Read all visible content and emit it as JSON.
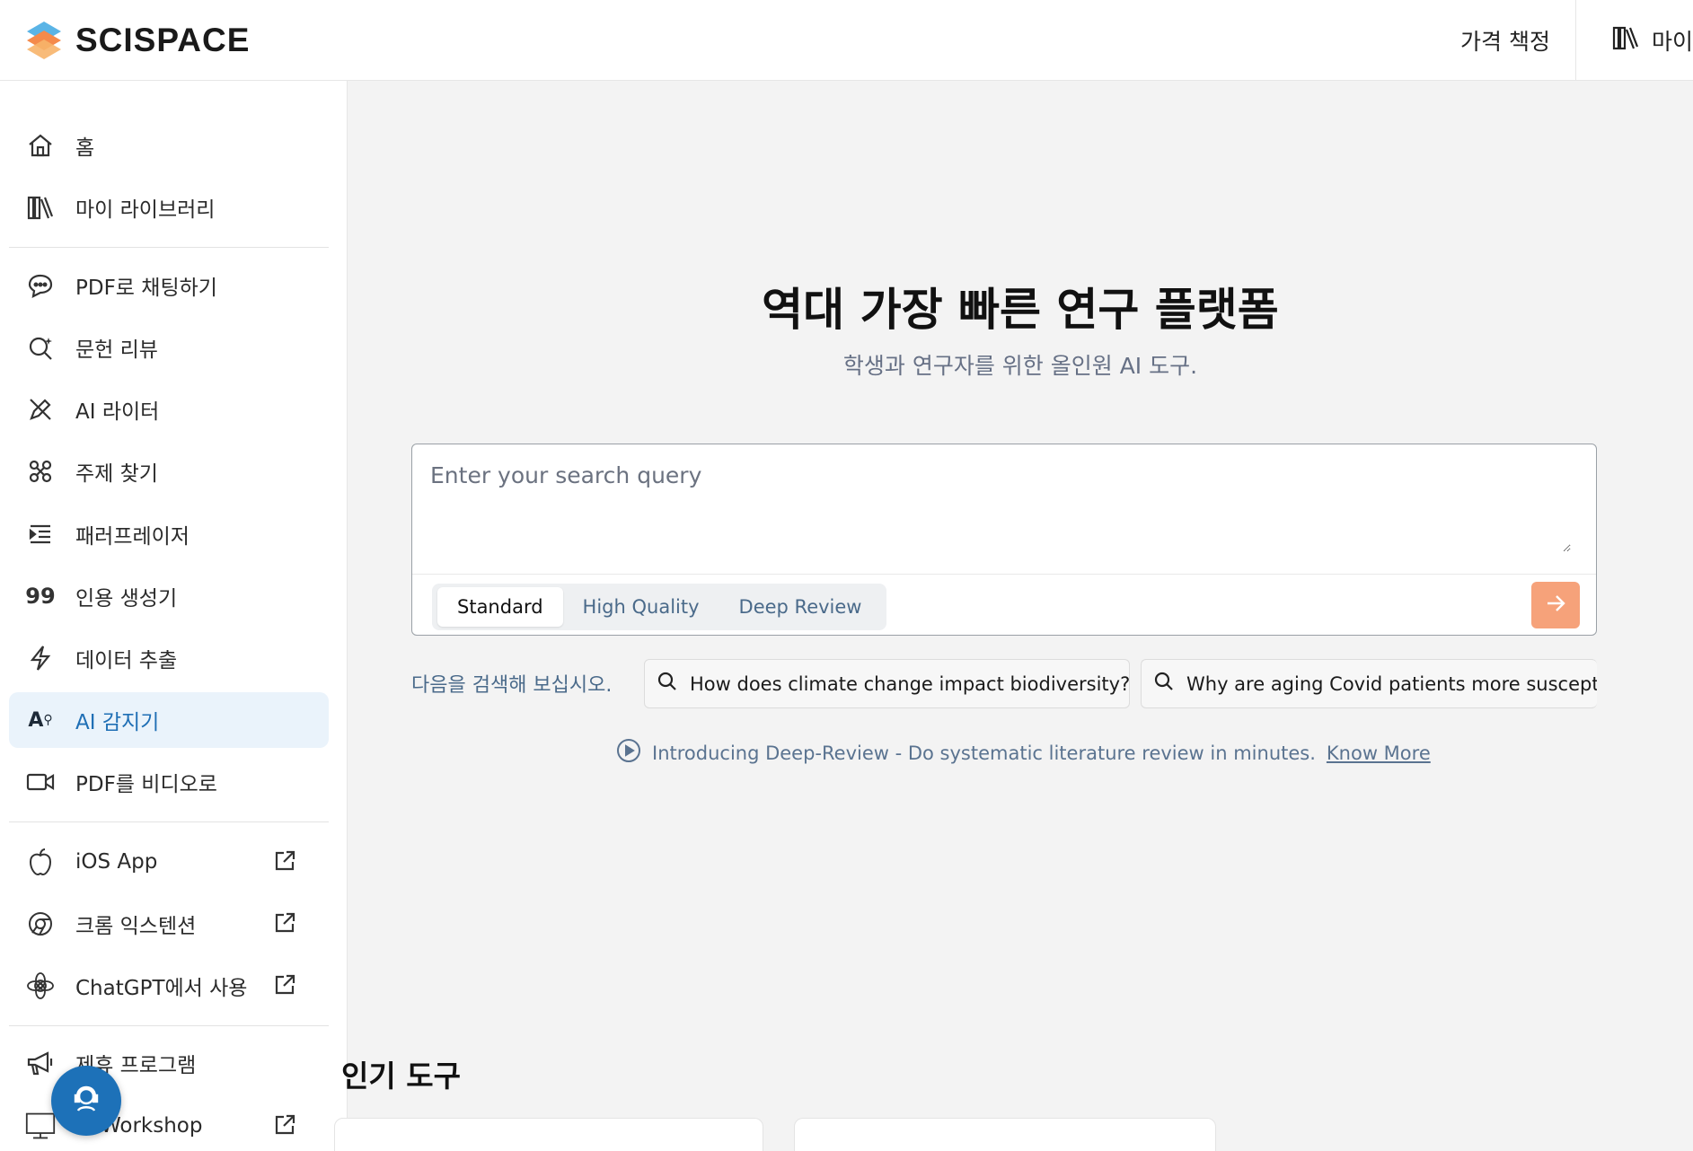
{
  "header": {
    "logo_text": "SCISPACE",
    "pricing": "가격 책정",
    "library": "마이"
  },
  "sidebar": {
    "items": [
      {
        "label": "홈",
        "icon": "home-icon"
      },
      {
        "label": "마이 라이브러리",
        "icon": "library-icon"
      },
      {
        "label": "PDF로 채팅하기",
        "icon": "chat-icon"
      },
      {
        "label": "문헌 리뷰",
        "icon": "literature-review-icon"
      },
      {
        "label": "AI 라이터",
        "icon": "pen-icon"
      },
      {
        "label": "주제 찾기",
        "icon": "topics-icon"
      },
      {
        "label": "패러프레이저",
        "icon": "paraphraser-icon"
      },
      {
        "label": "인용 생성기",
        "icon": "quote-icon"
      },
      {
        "label": "데이터 추출",
        "icon": "lightning-icon"
      },
      {
        "label": "AI 감지기",
        "icon": "ai-detector-icon"
      },
      {
        "label": "PDF를 비디오로",
        "icon": "video-icon"
      },
      {
        "label": "iOS App",
        "icon": "apple-icon"
      },
      {
        "label": "크롬 익스텐션",
        "icon": "chrome-icon"
      },
      {
        "label": "ChatGPT에서 사용",
        "icon": "openai-icon"
      },
      {
        "label": "제휴 프로그램",
        "icon": "megaphone-icon"
      },
      {
        "label": "Workshop",
        "icon": "workshop-icon"
      }
    ],
    "active_index": 9
  },
  "main": {
    "title": "역대 가장 빠른 연구 플랫폼",
    "subtitle": "학생과 연구자를 위한 올인원 AI 도구.",
    "search": {
      "placeholder": "Enter your search query",
      "modes": [
        "Standard",
        "High Quality",
        "Deep Review"
      ],
      "selected_mode": "Standard"
    },
    "try_label": "다음을 검색해 보십시오.",
    "suggestions": [
      "How does climate change impact biodiversity?",
      "Why are aging Covid patients more susceptib"
    ],
    "promo": {
      "text": "Introducing Deep-Review - Do systematic literature review in minutes.",
      "link": "Know More"
    },
    "popular_title": "인기 도구"
  },
  "colors": {
    "accent": "#f6a27a",
    "active_bg": "#eaf3fb",
    "active_text": "#1f6fb5",
    "fab": "#1d71b8"
  }
}
